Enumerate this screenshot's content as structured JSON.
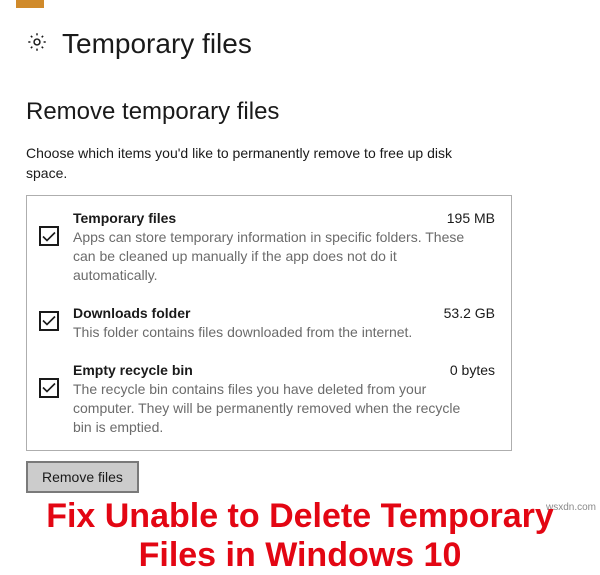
{
  "header": {
    "title": "Temporary files"
  },
  "section": {
    "title": "Remove temporary files",
    "description": "Choose which items you'd like to permanently remove to free up disk space."
  },
  "items": [
    {
      "title": "Temporary files",
      "size": "195 MB",
      "description": "Apps can store temporary information in specific folders. These can be cleaned up manually if the app does not do it automatically.",
      "checked": true
    },
    {
      "title": "Downloads folder",
      "size": "53.2 GB",
      "description": "This folder contains files downloaded from the internet.",
      "checked": true
    },
    {
      "title": "Empty recycle bin",
      "size": "0 bytes",
      "description": "The recycle bin contains files you have deleted from your computer. They will be permanently removed when the recycle bin is emptied.",
      "checked": true
    }
  ],
  "actions": {
    "remove_label": "Remove files"
  },
  "banner": {
    "text": "Fix Unable to Delete Temporary Files in Windows 10"
  },
  "watermark": "wsxdn.com"
}
